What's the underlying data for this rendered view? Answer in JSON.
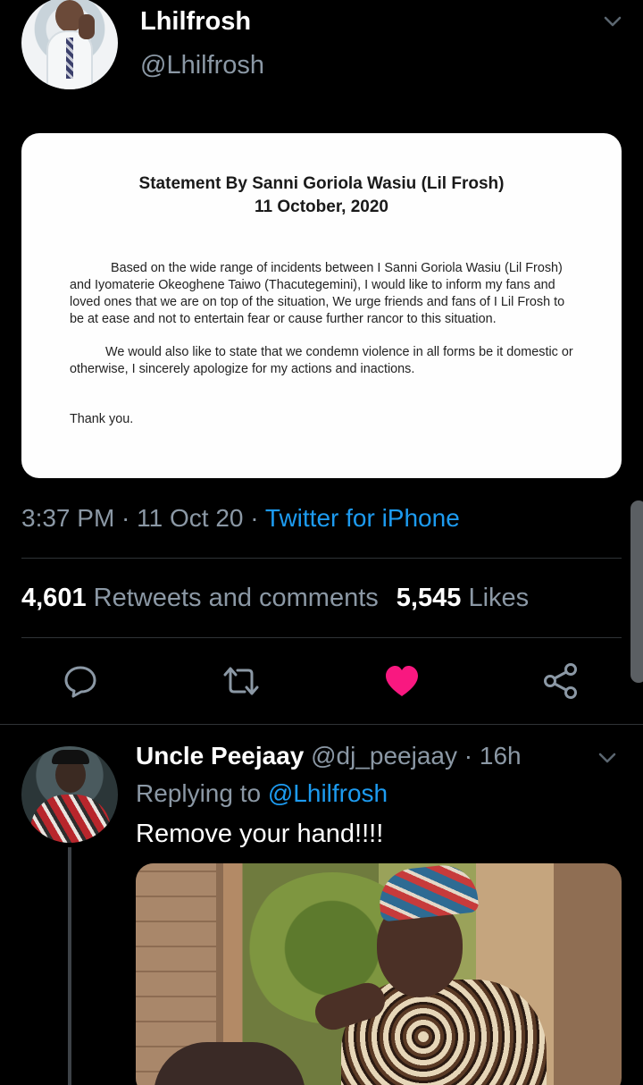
{
  "tweet": {
    "display_name": "Lhilfrosh",
    "handle": "@Lhilfrosh",
    "statement": {
      "title": "Statement By Sanni Goriola Wasiu (Lil Frosh)",
      "date": "11 October, 2020",
      "paragraph1": "Based on the wide range of incidents between I Sanni Goriola Wasiu (Lil Frosh) and Iyomaterie Okeoghene Taiwo (Thacutegemini), I would like to inform my fans and loved ones that we are on top of the situation, We urge friends and fans of I Lil Frosh to be at ease and not to entertain fear or cause further rancor to this situation.",
      "paragraph2": "We would also like to state that we condemn violence in all forms be it domestic or otherwise, I sincerely apologize for my actions and inactions.",
      "closing": "Thank you."
    },
    "time": "3:37 PM",
    "date": "11 Oct 20",
    "source": "Twitter for iPhone",
    "retweets_count": "4,601",
    "retweets_label": "Retweets and comments",
    "likes_count": "5,545",
    "likes_label": "Likes"
  },
  "reply": {
    "display_name": "Uncle Peejaay",
    "handle": "@dj_peejaay",
    "age": "16h",
    "replying_to_label": "Replying to",
    "replying_to_handle": "@Lhilfrosh",
    "text": "Remove your hand!!!!"
  },
  "colors": {
    "background": "#000000",
    "secondary_text": "#8b98a5",
    "link": "#1d9bf0",
    "like_active": "#f91880",
    "divider": "#2f3336"
  },
  "icons": [
    "chevron-down-icon",
    "reply-icon",
    "retweet-icon",
    "like-icon",
    "share-icon"
  ]
}
